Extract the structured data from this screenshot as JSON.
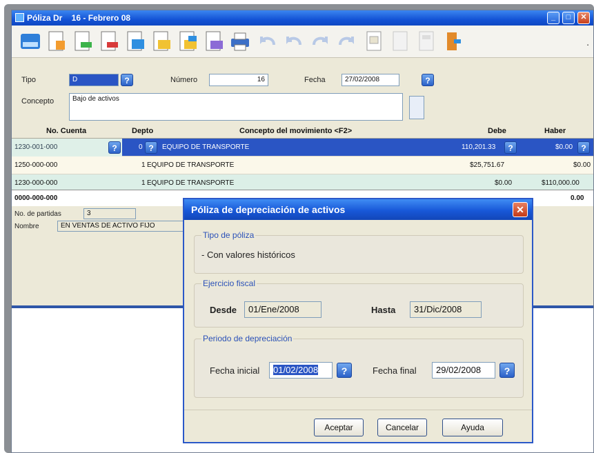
{
  "window": {
    "title": "Póliza Dr    16 - Febrero 08",
    "minimize": "_",
    "maximize": "□",
    "close": "✕"
  },
  "toolbar": {
    "icons": [
      "save-icon",
      "new-document-icon",
      "add-row-icon",
      "delete-row-icon",
      "copy-icon",
      "open-folder-icon",
      "paste-icon",
      "template-icon",
      "print-icon",
      "undo-icon",
      "undo-all-icon",
      "redo-icon",
      "redo-all-icon",
      "page-icon",
      "page-disabled-icon",
      "calculator-icon",
      "exit-door-icon"
    ],
    "more": "."
  },
  "header": {
    "tipo_label": "Tipo",
    "tipo_value": "D",
    "numero_label": "Número",
    "numero_value": "16",
    "fecha_label": "Fecha",
    "fecha_value": "27/02/2008",
    "concepto_label": "Concepto",
    "concepto_value": "Bajo de activos"
  },
  "grid": {
    "columns": [
      "No. Cuenta",
      "Depto",
      "Concepto del movimiento <F2>",
      "Debe",
      "Haber"
    ],
    "rows": [
      {
        "cuenta": "1230-001-000",
        "depto": "0",
        "concepto": "EQUIPO DE TRANSPORTE",
        "debe": "110,201.33",
        "haber": "$0.00"
      },
      {
        "cuenta": "1250-000-000",
        "depto": "1",
        "concepto": "EQUIPO DE TRANSPORTE",
        "debe": "$25,751.67",
        "haber": "$0.00"
      },
      {
        "cuenta": "1230-000-000",
        "depto": "1",
        "concepto": "EQUIPO DE TRANSPORTE",
        "debe": "$0.00",
        "haber": "$110,000.00"
      }
    ],
    "total_account": "0000-000-000",
    "total_haber": "0.00"
  },
  "footer": {
    "partidas_label": "No. de partidas",
    "partidas_value": "3",
    "nombre_label": "Nombre",
    "nombre_value": "EN VENTAS DE ACTIVO FIJO"
  },
  "dialog": {
    "title": "Póliza de depreciación de activos",
    "close": "✕",
    "tipo_poliza_caption": "Tipo de póliza",
    "tipo_poliza_value": "- Con valores históricos",
    "ejercicio_caption": "Ejercicio fiscal",
    "desde_label": "Desde",
    "desde_value": "01/Ene/2008",
    "hasta_label": "Hasta",
    "hasta_value": "31/Dic/2008",
    "periodo_caption": "Periodo de depreciación",
    "fecha_inicial_label": "Fecha inicial",
    "fecha_inicial_value": "01/02/2008",
    "fecha_final_label": "Fecha final",
    "fecha_final_value": "29/02/2008",
    "accept_label": "Aceptar",
    "cancel_label": "Cancelar",
    "help_label": "Ayuda",
    "help_glyph": "?"
  }
}
